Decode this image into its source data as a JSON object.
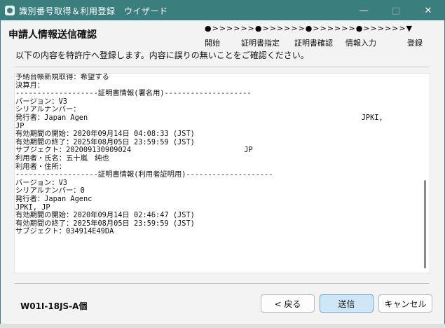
{
  "window": {
    "title": "識別番号取得＆利用登録　ウイザード"
  },
  "header": {
    "title": "申請人情報送信確認",
    "instruction": "以下の内容を特許庁へ登録します。内容に誤りの無いことをご確認ください。"
  },
  "steps": {
    "progress": "●>>>>>>●>>>>>>●>>>>>>●>>>>>>▼",
    "labels": [
      "開始",
      "証明書指定",
      "証明書確認",
      "情報入力",
      "登録"
    ],
    "current_index": 4
  },
  "content_lines": [
    "予納台帳新規取得：希望する",
    "決算月：",
    "",
    "-------------------証明書情報(署名用)--------------------",
    "バージョン：V3",
    "シリアルナンバー：",
    "発行者：Japan Agen                                                               JPKI,",
    "JP",
    "有効期間の開始：2020年09月14日 04:08:33 (JST)",
    "有効期間の終了：2025年08月05日 23:59:59 (JST)",
    "サブジェクト：202009130909024                          JP",
    "利用者・氏名：五十嵐　純也",
    "利用者・住所：",
    "",
    "-------------------証明書情報(利用者証明用)--------------------",
    "バージョン：V3",
    "シリアルナンバー：0",
    "発行者：Japan Agenc",
    "JPKI, JP",
    "有効期間の開始：2020年09月14日 02:46:47 (JST)",
    "有効期間の終了：2025年08月05日 23:59:59 (JST)",
    "サブジェクト：034914E49DA"
  ],
  "footer": {
    "form_id": "W01I-18JS-A個",
    "back_label": "< 戻る",
    "send_label": "送信",
    "cancel_label": "キャンセル"
  }
}
